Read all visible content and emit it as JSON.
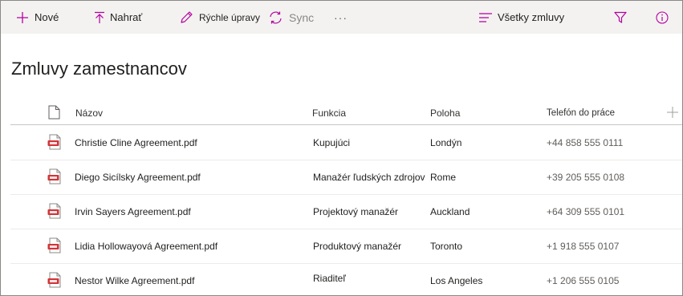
{
  "toolbar": {
    "new_label": "Nové",
    "upload_label": "Nahrať",
    "quick_edit_label": "Rýchle úpravy",
    "sync_label": "Sync",
    "more_label": "···",
    "view_label": "Všetky zmluvy"
  },
  "page": {
    "title": "Zmluvy zamestnancov"
  },
  "columns": {
    "name": "Názov",
    "function": "Funkcia",
    "location": "Poloha",
    "phone": "Telefón do práce"
  },
  "rows": [
    {
      "name": "Christie Cline Agreement.pdf",
      "function": "Kupujúci",
      "location": "Londýn",
      "phone": "+44 858 555 0111"
    },
    {
      "name": "Diego Sicílsky Agreement.pdf",
      "function": "Manažér ľudských zdrojov",
      "location": "Rome",
      "phone": "+39 205 555 0108"
    },
    {
      "name": "Irvin Sayers Agreement.pdf",
      "function": "Projektový manažér",
      "location": "Auckland",
      "phone": "+64 309 555 0101"
    },
    {
      "name": "Lidia Hollowayová Agreement.pdf",
      "function": "Produktový manažér",
      "location": "Toronto",
      "phone": "+1 918 555 0107"
    },
    {
      "name": "Nestor Wilke Agreement.pdf",
      "function": "Riaditeľ",
      "location": "Los Angeles",
      "phone": "+1 206 555 0105"
    }
  ],
  "colors": {
    "accent": "#b4009e",
    "pdf_red": "#d13438",
    "toolbar_bg": "#f3f2f1"
  },
  "icons": [
    "plus-icon",
    "upload-icon",
    "pencil-icon",
    "sync-icon",
    "more-icon",
    "view-lines-icon",
    "filter-icon",
    "info-icon",
    "file-icon",
    "pdf-icon",
    "add-column-icon"
  ]
}
